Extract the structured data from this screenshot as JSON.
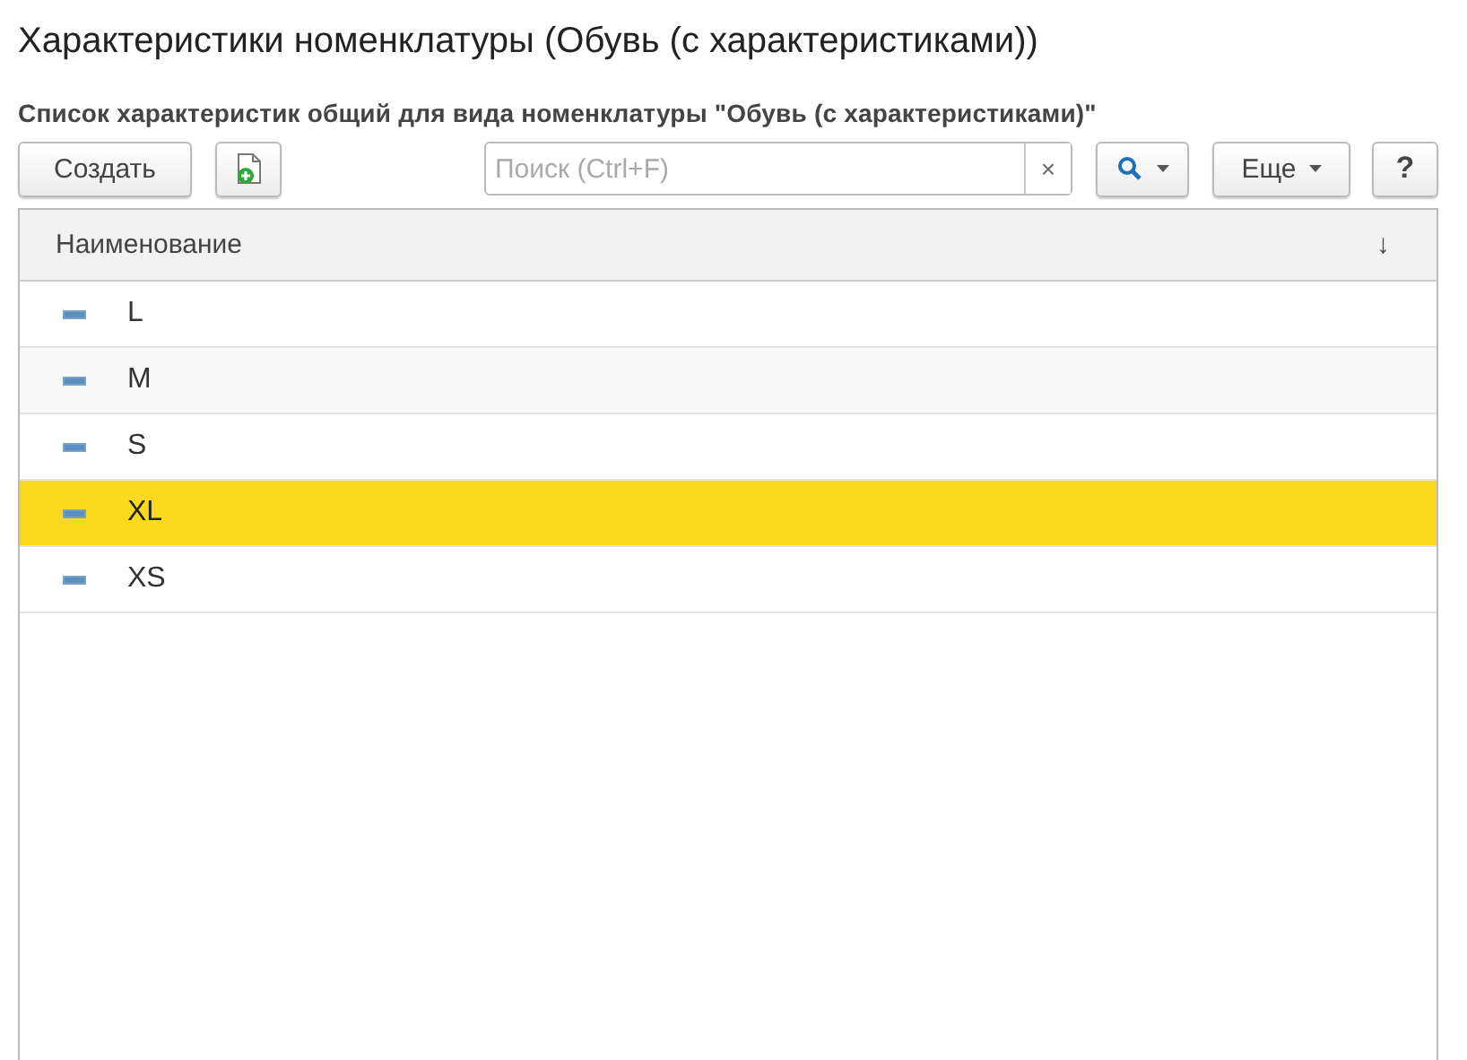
{
  "window": {
    "title": "Характеристики номенклатуры (Обувь (с характеристиками))"
  },
  "subtitle": "Список характеристик общий для вида номенклатуры \"Обувь (с характеристиками)\"",
  "toolbar": {
    "create_button": "Создать",
    "search": {
      "placeholder": "Поиск (Ctrl+F)",
      "clear": "×"
    },
    "more_button": "Еще",
    "help_button": "?"
  },
  "table": {
    "columns": [
      {
        "label": "Наименование",
        "sort": "↓"
      }
    ],
    "rows": [
      {
        "name": "L",
        "selected": false
      },
      {
        "name": "M",
        "selected": false
      },
      {
        "name": "S",
        "selected": false
      },
      {
        "name": "XL",
        "selected": true
      },
      {
        "name": "XS",
        "selected": false
      }
    ]
  }
}
